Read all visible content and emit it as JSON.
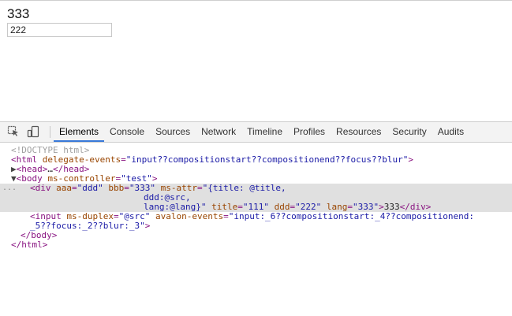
{
  "page": {
    "text": "333",
    "input_value": "222"
  },
  "devtools": {
    "tabs": [
      {
        "label": "Elements",
        "active": true
      },
      {
        "label": "Console"
      },
      {
        "label": "Sources"
      },
      {
        "label": "Network"
      },
      {
        "label": "Timeline"
      },
      {
        "label": "Profiles"
      },
      {
        "label": "Resources"
      },
      {
        "label": "Security"
      },
      {
        "label": "Audits"
      }
    ],
    "selected_marker": "...",
    "dom": {
      "doctype": "<!DOCTYPE html>",
      "html_open_tag": "<html",
      "html_attr_name": "delegate-events",
      "html_attr_value": "\"input??compositionstart??compositionend??focus??blur\"",
      "html_close_bracket": ">",
      "head_triangle": "▶",
      "head_open": "<head>",
      "head_ellipsis": "…",
      "head_close": "</head>",
      "body_triangle": "▼",
      "body_open_tag": "<body",
      "body_attr_name": "ms-controller",
      "body_attr_value": "\"test\"",
      "body_close_bracket": ">",
      "div_open_tag": "<div",
      "div_attr1_name": "aaa",
      "div_attr1_value": "\"ddd\"",
      "div_attr2_name": "bbb",
      "div_attr2_value": "\"333\"",
      "div_attr3_name": "ms-attr",
      "div_attr3_value_l1": "\"{title: @title,",
      "div_attr3_value_l2": "ddd:@src,",
      "div_attr3_value_l3": "lang:@lang}\"",
      "div_attr4_name": "title",
      "div_attr4_value": "\"111\"",
      "div_attr5_name": "ddd",
      "div_attr5_value": "\"222\"",
      "div_attr6_name": "lang",
      "div_attr6_value": "\"333\"",
      "div_close_bracket": ">",
      "div_text": "333",
      "div_close": "</div>",
      "input_open_tag": "<input",
      "input_attr1_name": "ms-duplex",
      "input_attr1_value": "\"@src\"",
      "input_attr2_name": "avalon-events",
      "input_attr2_value_l1": "\"input:_6??compositionstart:_4??compositionend:",
      "input_attr2_value_l2": "_5??focus:_2??blur:_3\"",
      "input_close_bracket": ">",
      "body_close": "</body>",
      "html_close": "</html>"
    }
  }
}
